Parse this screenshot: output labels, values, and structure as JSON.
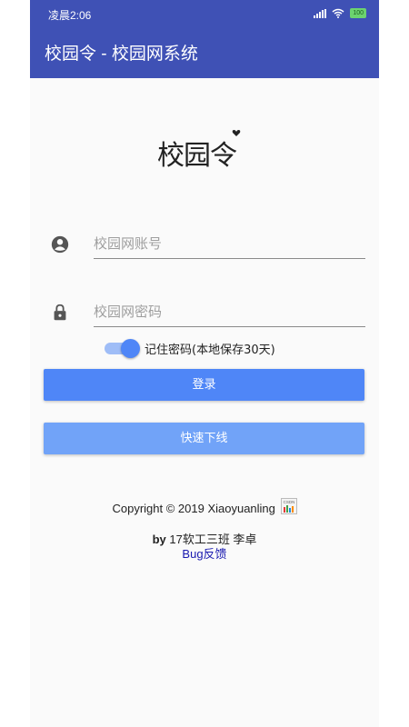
{
  "status_bar": {
    "time": "凌晨2:06",
    "battery": "100"
  },
  "app_bar": {
    "title": "校园令 - 校园网系统"
  },
  "logo": {
    "text": "校园令"
  },
  "form": {
    "account_placeholder": "校园网账号",
    "password_placeholder": "校园网密码",
    "remember_label": "记住密码(本地保存30天)",
    "remember_checked": true
  },
  "buttons": {
    "login": "登录",
    "quick_offline": "快速下线"
  },
  "footer": {
    "copyright": "Copyright © 2019 Xiaoyuanling",
    "csdn_badge": "CSDN",
    "by_label": "by",
    "author": "17软工三班 李卓",
    "bug_link": "Bug反馈"
  },
  "colors": {
    "primary": "#3f51b5",
    "accent": "#4f86f7",
    "button_secondary": "#71a3f8",
    "link": "#1a1ab0"
  },
  "icons": {
    "account": "account-circle-icon",
    "password": "lock-icon"
  }
}
